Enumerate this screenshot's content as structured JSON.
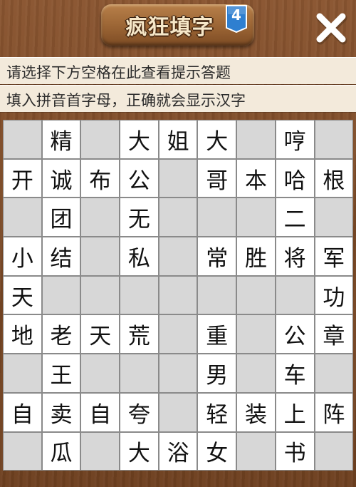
{
  "header": {
    "title": "疯狂填字",
    "level": "4",
    "close_icon": "close-icon"
  },
  "hints": {
    "line1": "请选择下方空格在此查看提示答题",
    "line2": "填入拼音首字母，正确就会显示汉字"
  },
  "grid": {
    "rows": [
      [
        "",
        "精",
        "",
        "大",
        "姐",
        "大",
        "",
        "哼",
        ""
      ],
      [
        "开",
        "诚",
        "布",
        "公",
        "",
        "哥",
        "本",
        "哈",
        "根"
      ],
      [
        "",
        "团",
        "",
        "无",
        "",
        "",
        "",
        "二",
        ""
      ],
      [
        "小",
        "结",
        "",
        "私",
        "",
        "常",
        "胜",
        "将",
        "军"
      ],
      [
        "天",
        "",
        "",
        "",
        "",
        "",
        "",
        "",
        "功"
      ],
      [
        "地",
        "老",
        "天",
        "荒",
        "",
        "重",
        "",
        "公",
        "章"
      ],
      [
        "",
        "王",
        "",
        "",
        "",
        "男",
        "",
        "车",
        ""
      ],
      [
        "自",
        "卖",
        "自",
        "夸",
        "",
        "轻",
        "装",
        "上",
        "阵"
      ],
      [
        "",
        "瓜",
        "",
        "大",
        "浴",
        "女",
        "",
        "书",
        ""
      ]
    ]
  },
  "colors": {
    "filled_cell": "#ffffff",
    "empty_cell": "#d7d7d7",
    "grid_line": "#8a8a8a",
    "hint_bar": "#f3eadb",
    "level_badge": "#2f7fd0"
  }
}
